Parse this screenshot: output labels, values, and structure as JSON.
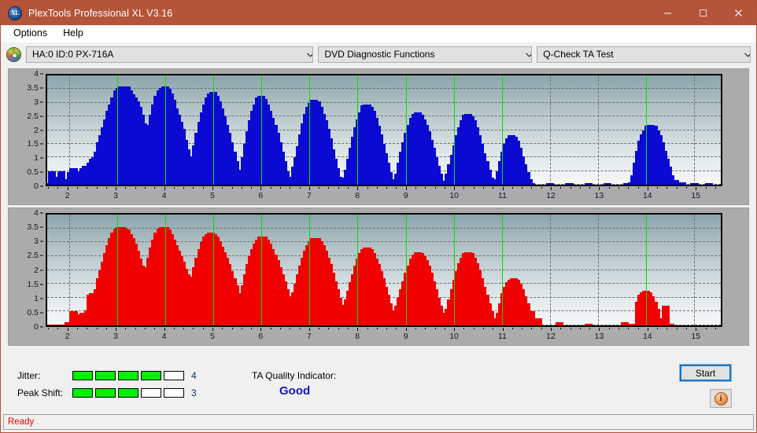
{
  "window": {
    "title": "PlexTools Professional XL V3.16",
    "icon": "disc-logo-icon",
    "controls": {
      "minimize": "minimize-icon",
      "maximize": "maximize-icon",
      "close": "close-icon"
    }
  },
  "menu": {
    "items": [
      {
        "label": "Options"
      },
      {
        "label": "Help"
      }
    ]
  },
  "toolbar": {
    "drive_icon": "disc-icon",
    "drive": {
      "value": "HA:0 ID:0  PX-716A"
    },
    "function": {
      "value": "DVD Diagnostic Functions"
    },
    "test": {
      "value": "Q-Check TA Test"
    }
  },
  "results": {
    "jitter": {
      "label": "Jitter:",
      "value": "4",
      "filled": 4,
      "total": 5
    },
    "peak_shift": {
      "label": "Peak Shift:",
      "value": "3",
      "filled": 3,
      "total": 5
    },
    "quality": {
      "label": "TA Quality Indicator:",
      "value": "Good",
      "color": "#1414c8"
    },
    "start_button": "Start",
    "info_button": "info-icon"
  },
  "statusbar": {
    "text": "Ready"
  },
  "colors": {
    "titlebar": "#b4543a",
    "jitter_series": "#0a0ad2",
    "peak_shift_series": "#f00000",
    "marker": "#00e000",
    "status": "#ee0000"
  },
  "chart_data": [
    {
      "type": "bar",
      "title": "Jitter",
      "series_name": "Jitter",
      "color": "#0a0ad2",
      "xlabel": "",
      "ylabel": "",
      "xlim": [
        1.55,
        15.55
      ],
      "ylim": [
        0,
        4
      ],
      "yticks": [
        0,
        0.5,
        1,
        1.5,
        2,
        2.5,
        3,
        3.5,
        4
      ],
      "xticks": [
        2,
        3,
        4,
        5,
        6,
        7,
        8,
        9,
        10,
        11,
        12,
        13,
        14,
        15
      ],
      "grid": true,
      "markers": [
        3,
        4,
        5,
        6,
        7,
        8,
        9,
        10,
        11,
        14
      ],
      "x": [
        1.6,
        1.65,
        1.7,
        1.75,
        1.8,
        1.85,
        1.9,
        1.95,
        2.0,
        2.05,
        2.1,
        2.15,
        2.2,
        2.25,
        2.3,
        2.35,
        2.4,
        2.45,
        2.5,
        2.55,
        2.6,
        2.65,
        2.7,
        2.75,
        2.8,
        2.85,
        2.9,
        2.95,
        3.0,
        3.05,
        3.1,
        3.15,
        3.2,
        3.25,
        3.3,
        3.35,
        3.4,
        3.45,
        3.5,
        3.55,
        3.6,
        3.65,
        3.7,
        3.75,
        3.8,
        3.85,
        3.9,
        3.95,
        4.0,
        4.05,
        4.1,
        4.15,
        4.2,
        4.25,
        4.3,
        4.35,
        4.4,
        4.45,
        4.5,
        4.55,
        4.6,
        4.65,
        4.7,
        4.75,
        4.8,
        4.85,
        4.9,
        4.95,
        5.0,
        5.05,
        5.1,
        5.15,
        5.2,
        5.25,
        5.3,
        5.35,
        5.4,
        5.45,
        5.5,
        5.55,
        5.6,
        5.65,
        5.7,
        5.75,
        5.8,
        5.85,
        5.9,
        5.95,
        6.0,
        6.05,
        6.1,
        6.15,
        6.2,
        6.25,
        6.3,
        6.35,
        6.4,
        6.45,
        6.5,
        6.55,
        6.6,
        6.65,
        6.7,
        6.75,
        6.8,
        6.85,
        6.9,
        6.95,
        7.0,
        7.05,
        7.1,
        7.15,
        7.2,
        7.25,
        7.3,
        7.35,
        7.4,
        7.45,
        7.5,
        7.55,
        7.6,
        7.65,
        7.7,
        7.75,
        7.8,
        7.85,
        7.9,
        7.95,
        8.0,
        8.05,
        8.1,
        8.15,
        8.2,
        8.25,
        8.3,
        8.35,
        8.4,
        8.45,
        8.5,
        8.55,
        8.6,
        8.65,
        8.7,
        8.75,
        8.8,
        8.85,
        8.9,
        8.95,
        9.0,
        9.05,
        9.1,
        9.15,
        9.2,
        9.25,
        9.3,
        9.35,
        9.4,
        9.45,
        9.5,
        9.55,
        9.6,
        9.65,
        9.7,
        9.75,
        9.8,
        9.85,
        9.9,
        9.95,
        10.0,
        10.05,
        10.1,
        10.15,
        10.2,
        10.25,
        10.3,
        10.35,
        10.4,
        10.45,
        10.5,
        10.55,
        10.6,
        10.65,
        10.7,
        10.75,
        10.8,
        10.85,
        10.9,
        10.95,
        11.0,
        11.05,
        11.1,
        11.15,
        11.2,
        11.25,
        11.3,
        11.35,
        11.4,
        11.45,
        11.5,
        11.55,
        11.6,
        12.0,
        12.4,
        12.8,
        13.2,
        13.6,
        13.7,
        13.75,
        13.8,
        13.85,
        13.9,
        13.95,
        14.0,
        14.05,
        14.1,
        14.15,
        14.2,
        14.25,
        14.3,
        14.35,
        14.4,
        14.45,
        14.5,
        14.6,
        14.75,
        15.0,
        15.3
      ],
      "values": [
        0.05,
        0.5,
        0.05,
        0.3,
        0.05,
        0.5,
        0.05,
        0.2,
        0.05,
        0.45,
        0.6,
        0.1,
        0.45,
        0.5,
        0.6,
        0.7,
        0.5,
        0.8,
        0.95,
        1.0,
        1.2,
        1.55,
        1.8,
        2.1,
        2.4,
        2.7,
        2.95,
        3.2,
        3.45,
        3.55,
        3.6,
        3.55,
        3.6,
        3.45,
        3.3,
        3.2,
        3.05,
        2.85,
        2.55,
        2.25,
        2.05,
        1.95,
        2.2,
        2.55,
        2.95,
        3.25,
        3.45,
        3.55,
        3.6,
        3.5,
        3.35,
        3.1,
        2.8,
        2.55,
        2.3,
        2.05,
        1.65,
        1.3,
        1.05,
        0.9,
        1.05,
        1.45,
        1.9,
        2.3,
        2.65,
        2.95,
        3.2,
        3.35,
        3.4,
        3.25,
        3.05,
        2.8,
        2.5,
        2.2,
        1.9,
        1.55,
        1.2,
        0.85,
        0.55,
        0.3,
        0.55,
        1.0,
        1.5,
        1.95,
        2.35,
        2.7,
        2.95,
        3.2,
        3.25,
        3.15,
        2.95,
        2.7,
        2.45,
        2.2,
        1.9,
        1.55,
        1.2,
        0.85,
        0.5,
        0.2,
        0.1,
        0.3,
        0.65,
        1.0,
        1.4,
        1.85,
        2.25,
        2.6,
        2.85,
        3.0,
        3.1,
        3.05,
        2.85,
        2.6,
        2.35,
        2.05,
        1.7,
        1.3,
        0.95,
        0.6,
        0.3,
        0.1,
        0.05,
        0.25,
        0.55,
        0.95,
        1.35,
        1.75,
        2.1,
        2.4,
        2.65,
        2.9,
        2.95,
        2.85,
        2.7,
        2.45,
        2.15,
        1.85,
        1.5,
        1.15,
        0.8,
        0.45,
        0.2,
        0.05,
        0.15,
        0.4,
        0.8,
        1.2,
        1.55,
        1.9,
        2.2,
        2.45,
        2.6,
        2.65,
        2.55,
        2.4,
        2.2,
        1.95,
        1.65,
        1.35,
        1.0,
        0.7,
        0.4,
        0.15,
        0.05,
        0.15,
        0.4,
        0.75,
        1.1,
        1.45,
        1.8,
        2.1,
        2.35,
        2.55,
        2.6,
        2.5,
        2.35,
        2.1,
        1.8,
        1.5,
        1.15,
        0.85,
        0.55,
        0.25,
        0.08,
        0.05,
        0.2,
        0.5,
        0.85,
        1.2,
        1.5,
        1.7,
        1.8,
        1.75,
        1.6,
        1.35,
        1.05,
        0.75,
        0.45,
        0.2,
        0.05,
        0.05,
        0.05,
        0.05,
        0.05,
        0.05,
        0.08,
        0.35,
        0.8,
        1.25,
        1.6,
        1.85,
        2.0,
        2.15,
        2.2,
        2.15,
        2.0,
        1.8,
        1.55,
        1.25,
        0.95,
        0.65,
        0.35,
        0.18,
        0.08,
        0.05,
        0.05
      ]
    },
    {
      "type": "bar",
      "title": "Peak Shift",
      "series_name": "Peak Shift",
      "color": "#f00000",
      "xlabel": "",
      "ylabel": "",
      "xlim": [
        1.55,
        15.55
      ],
      "ylim": [
        0,
        4
      ],
      "yticks": [
        0,
        0.5,
        1,
        1.5,
        2,
        2.5,
        3,
        3.5,
        4
      ],
      "xticks": [
        2,
        3,
        4,
        5,
        6,
        7,
        8,
        9,
        10,
        11,
        12,
        13,
        14,
        15
      ],
      "grid": true,
      "markers": [
        3,
        4,
        5,
        6,
        7,
        8,
        9,
        10,
        11,
        14
      ],
      "x": [
        1.6,
        1.65,
        1.7,
        1.75,
        1.8,
        1.85,
        1.9,
        1.95,
        2.0,
        2.05,
        2.1,
        2.15,
        2.2,
        2.25,
        2.3,
        2.35,
        2.4,
        2.45,
        2.5,
        2.55,
        2.6,
        2.65,
        2.7,
        2.75,
        2.8,
        2.85,
        2.9,
        2.95,
        3.0,
        3.05,
        3.1,
        3.15,
        3.2,
        3.25,
        3.3,
        3.35,
        3.4,
        3.45,
        3.5,
        3.55,
        3.6,
        3.65,
        3.7,
        3.75,
        3.8,
        3.85,
        3.9,
        3.95,
        4.0,
        4.05,
        4.1,
        4.15,
        4.2,
        4.25,
        4.3,
        4.35,
        4.4,
        4.45,
        4.5,
        4.55,
        4.6,
        4.65,
        4.7,
        4.75,
        4.8,
        4.85,
        4.9,
        4.95,
        5.0,
        5.05,
        5.1,
        5.15,
        5.2,
        5.25,
        5.3,
        5.35,
        5.4,
        5.45,
        5.5,
        5.55,
        5.6,
        5.65,
        5.7,
        5.75,
        5.8,
        5.85,
        5.9,
        5.95,
        6.0,
        6.05,
        6.1,
        6.15,
        6.2,
        6.25,
        6.3,
        6.35,
        6.4,
        6.45,
        6.5,
        6.55,
        6.6,
        6.65,
        6.7,
        6.75,
        6.8,
        6.85,
        6.9,
        6.95,
        7.0,
        7.05,
        7.1,
        7.15,
        7.2,
        7.25,
        7.3,
        7.35,
        7.4,
        7.45,
        7.5,
        7.55,
        7.6,
        7.65,
        7.7,
        7.75,
        7.8,
        7.85,
        7.9,
        7.95,
        8.0,
        8.05,
        8.1,
        8.15,
        8.2,
        8.25,
        8.3,
        8.35,
        8.4,
        8.45,
        8.5,
        8.55,
        8.6,
        8.65,
        8.7,
        8.75,
        8.8,
        8.85,
        8.9,
        8.95,
        9.0,
        9.05,
        9.1,
        9.15,
        9.2,
        9.25,
        9.3,
        9.35,
        9.4,
        9.45,
        9.5,
        9.55,
        9.6,
        9.65,
        9.7,
        9.75,
        9.8,
        9.85,
        9.9,
        9.95,
        10.0,
        10.05,
        10.1,
        10.15,
        10.2,
        10.25,
        10.3,
        10.35,
        10.4,
        10.45,
        10.5,
        10.55,
        10.6,
        10.65,
        10.7,
        10.75,
        10.8,
        10.85,
        10.9,
        10.95,
        11.0,
        11.05,
        11.1,
        11.15,
        11.2,
        11.25,
        11.3,
        11.35,
        11.4,
        11.45,
        11.5,
        11.6,
        11.75,
        12.2,
        12.8,
        13.55,
        13.7,
        13.8,
        13.85,
        13.9,
        13.95,
        14.0,
        14.05,
        14.1,
        14.15,
        14.2,
        14.25,
        14.3,
        14.4,
        14.5,
        14.65
      ],
      "values": [
        0.02,
        0.02,
        0.02,
        0.02,
        0.02,
        0.02,
        0.02,
        0.02,
        0.1,
        0.05,
        0.5,
        0.1,
        0.4,
        0.05,
        0.45,
        0.3,
        0.55,
        1.1,
        1.15,
        1.05,
        1.3,
        1.7,
        2.0,
        2.3,
        2.6,
        2.9,
        3.15,
        3.35,
        3.5,
        3.55,
        3.55,
        3.5,
        3.45,
        3.3,
        3.15,
        2.95,
        2.7,
        2.4,
        2.15,
        1.95,
        1.9,
        2.1,
        2.45,
        2.8,
        3.1,
        3.35,
        3.5,
        3.55,
        3.55,
        3.45,
        3.3,
        3.1,
        2.9,
        2.7,
        2.5,
        2.3,
        2.05,
        1.85,
        1.7,
        1.6,
        1.75,
        2.1,
        2.45,
        2.75,
        3.0,
        3.2,
        3.3,
        3.35,
        3.3,
        3.2,
        3.05,
        2.85,
        2.65,
        2.45,
        2.2,
        1.95,
        1.7,
        1.45,
        1.15,
        0.95,
        1.1,
        1.45,
        1.85,
        2.2,
        2.5,
        2.75,
        2.95,
        3.1,
        3.2,
        3.2,
        3.1,
        2.95,
        2.75,
        2.55,
        2.35,
        2.1,
        1.85,
        1.6,
        1.3,
        1.05,
        0.85,
        0.95,
        1.2,
        1.5,
        1.85,
        2.15,
        2.45,
        2.7,
        2.9,
        3.05,
        3.15,
        3.15,
        3.05,
        2.9,
        2.7,
        2.45,
        2.2,
        1.9,
        1.6,
        1.3,
        1.0,
        0.75,
        0.6,
        0.7,
        0.95,
        1.25,
        1.55,
        1.85,
        2.15,
        2.4,
        2.6,
        2.75,
        2.8,
        2.75,
        2.6,
        2.4,
        2.2,
        1.95,
        1.7,
        1.4,
        1.1,
        0.8,
        0.55,
        0.35,
        0.45,
        0.7,
        1.0,
        1.3,
        1.6,
        1.9,
        2.15,
        2.4,
        2.55,
        2.65,
        2.6,
        2.5,
        2.35,
        2.15,
        1.9,
        1.6,
        1.3,
        1.0,
        0.7,
        0.45,
        0.25,
        0.35,
        0.6,
        0.95,
        1.3,
        1.65,
        1.95,
        2.25,
        2.45,
        2.6,
        2.65,
        2.6,
        2.45,
        2.25,
        2.0,
        1.7,
        1.4,
        1.1,
        0.8,
        0.5,
        0.25,
        0.1,
        0.2,
        0.45,
        0.8,
        1.15,
        1.4,
        1.55,
        1.65,
        1.7,
        1.65,
        1.5,
        1.3,
        1.05,
        0.8,
        0.5,
        0.25,
        0.1,
        0.05,
        0.1,
        0.05,
        0.05,
        0.85,
        1.1,
        1.2,
        1.25,
        1.2,
        1.05,
        0.85,
        0.6,
        0.25,
        0.1,
        0.7,
        0.05
      ]
    }
  ]
}
